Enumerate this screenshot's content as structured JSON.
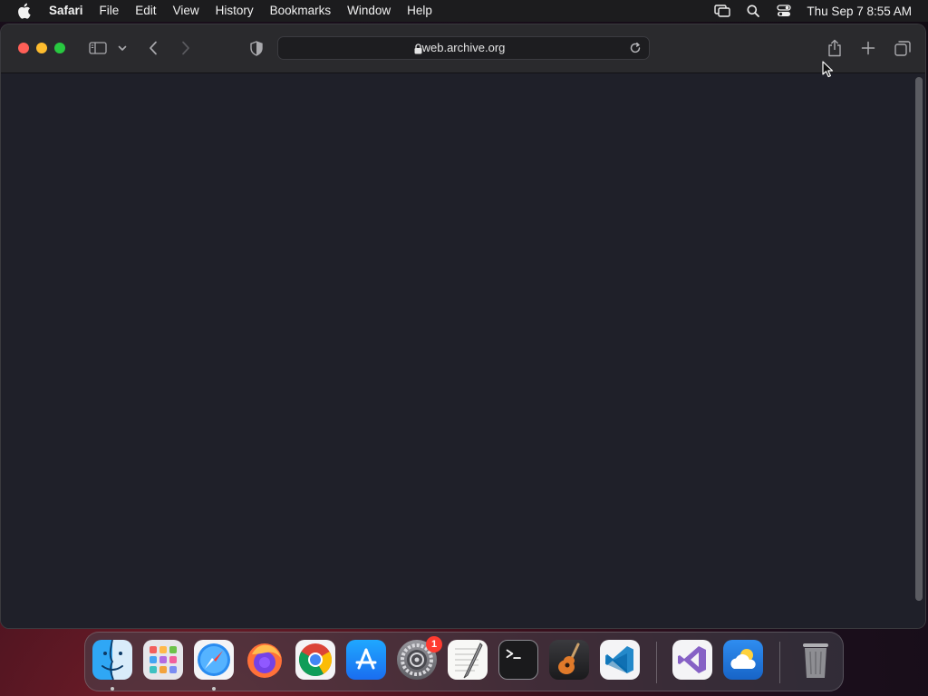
{
  "menubar": {
    "app_name": "Safari",
    "menus": [
      "File",
      "Edit",
      "View",
      "History",
      "Bookmarks",
      "Window",
      "Help"
    ],
    "clock": "Thu Sep 7  8:55 AM",
    "status_icons": [
      "screen-mirroring-icon",
      "spotlight-search-icon",
      "control-center-icon"
    ]
  },
  "browser": {
    "url": "web.archive.org",
    "colors": {
      "toolbar": "#2a2a2d",
      "content": "#1f2029"
    }
  },
  "dock": {
    "apps": [
      {
        "name": "Finder",
        "icon": "finder-icon",
        "running": true
      },
      {
        "name": "Launchpad",
        "icon": "launchpad-icon",
        "running": false
      },
      {
        "name": "Safari",
        "icon": "safari-icon",
        "running": true
      },
      {
        "name": "Firefox",
        "icon": "firefox-icon",
        "running": false
      },
      {
        "name": "Google Chrome",
        "icon": "chrome-icon",
        "running": false
      },
      {
        "name": "App Store",
        "icon": "app-store-icon",
        "running": false
      },
      {
        "name": "System Settings",
        "icon": "system-settings-icon",
        "running": false,
        "badge": "1"
      },
      {
        "name": "TextEdit",
        "icon": "textedit-icon",
        "running": false
      },
      {
        "name": "Terminal",
        "icon": "terminal-icon",
        "running": false
      },
      {
        "name": "GarageBand",
        "icon": "garageband-icon",
        "running": false
      },
      {
        "name": "Visual Studio Code",
        "icon": "vscode-icon",
        "running": false
      },
      {
        "name": "Visual Studio",
        "icon": "visual-studio-icon",
        "running": false
      },
      {
        "name": "Weather",
        "icon": "weather-icon",
        "running": false
      },
      {
        "name": "Trash",
        "icon": "trash-icon",
        "running": false
      }
    ]
  }
}
